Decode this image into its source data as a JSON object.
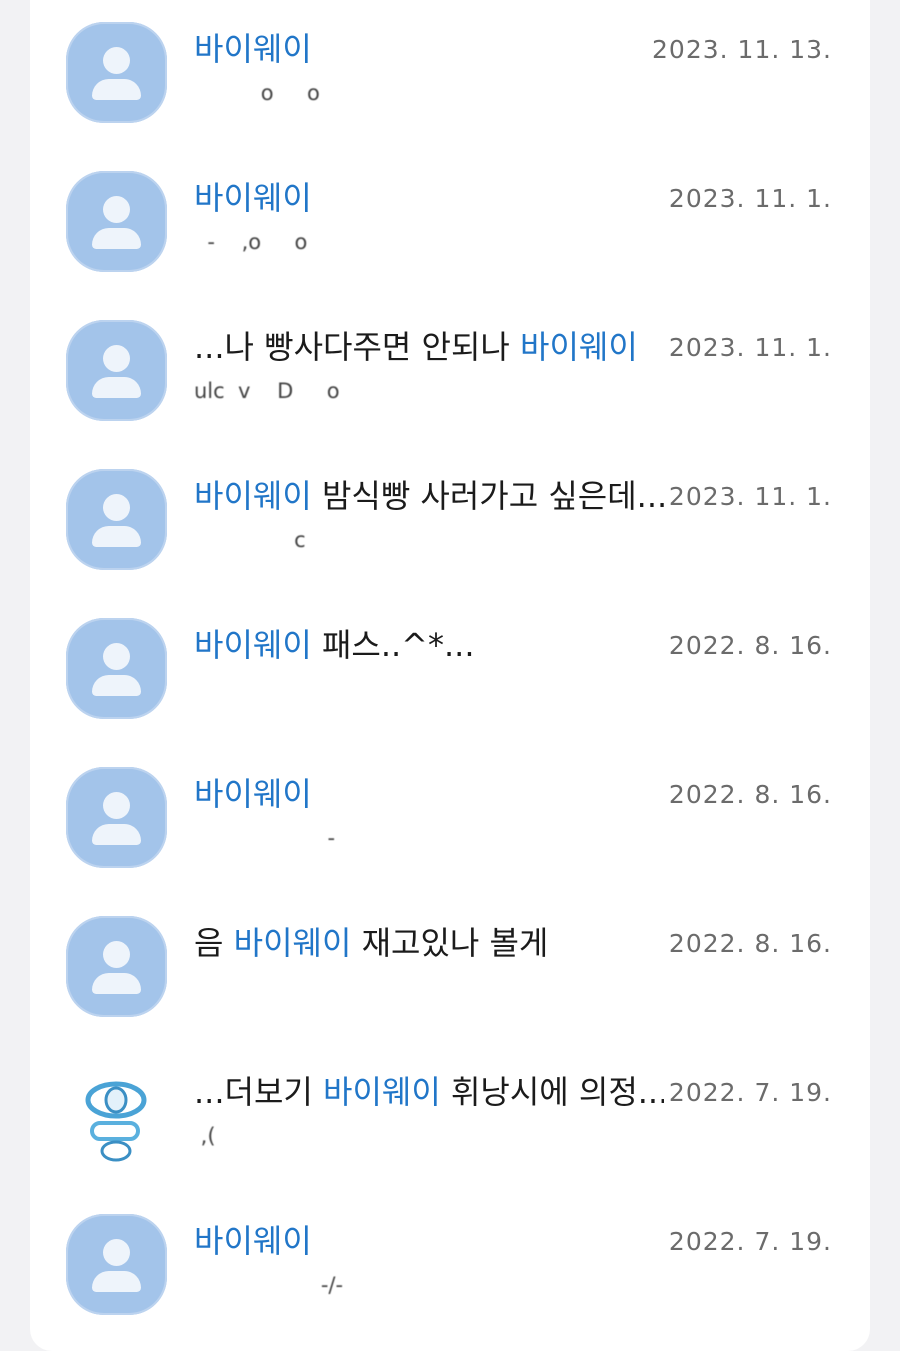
{
  "keyword_color": "#2176c8",
  "avatar_color": "#a3c4ea",
  "rows": [
    {
      "avatar": "default-avatar-icon",
      "parts": [
        {
          "text": "바이웨이",
          "kw": true
        }
      ],
      "date": "2023. 11. 13.",
      "preview": "          o     o"
    },
    {
      "avatar": "default-avatar-icon",
      "parts": [
        {
          "text": "바이웨이",
          "kw": true
        }
      ],
      "date": "2023. 11. 1.",
      "preview": "  -    ,o     o"
    },
    {
      "avatar": "default-avatar-icon",
      "parts": [
        {
          "text": "...나 빵사다주면 안되나 ",
          "kw": false
        },
        {
          "text": "바이웨이",
          "kw": true
        }
      ],
      "date": "2023. 11. 1.",
      "preview": "ulc  v    D     o"
    },
    {
      "avatar": "default-avatar-icon",
      "parts": [
        {
          "text": "바이웨이",
          "kw": true
        },
        {
          "text": " 밤식빵 사러가고 싶은데...",
          "kw": false
        }
      ],
      "date": "2023. 11. 1.",
      "preview": "               c"
    },
    {
      "avatar": "default-avatar-icon",
      "parts": [
        {
          "text": "바이웨이",
          "kw": true
        },
        {
          "text": " 패스..^*...",
          "kw": false
        }
      ],
      "date": "2022. 8. 16.",
      "preview": ""
    },
    {
      "avatar": "default-avatar-icon",
      "parts": [
        {
          "text": "바이웨이",
          "kw": true
        }
      ],
      "date": "2022. 8. 16.",
      "preview": "                    -"
    },
    {
      "avatar": "default-avatar-icon",
      "parts": [
        {
          "text": "음 ",
          "kw": false
        },
        {
          "text": "바이웨이",
          "kw": true
        },
        {
          "text": " 재고있나 볼게",
          "kw": false
        }
      ],
      "date": "2022. 8. 16.",
      "preview": ""
    },
    {
      "avatar": "custom-profile-icon",
      "parts": [
        {
          "text": "...더보기 ",
          "kw": false
        },
        {
          "text": "바이웨이",
          "kw": true
        },
        {
          "text": " 휘낭시에 의정...",
          "kw": false
        }
      ],
      "date": "2022. 7. 19.",
      "preview": " ,("
    },
    {
      "avatar": "default-avatar-icon",
      "parts": [
        {
          "text": "바이웨이",
          "kw": true
        }
      ],
      "date": "2022. 7. 19.",
      "preview": "                   -/-"
    }
  ]
}
